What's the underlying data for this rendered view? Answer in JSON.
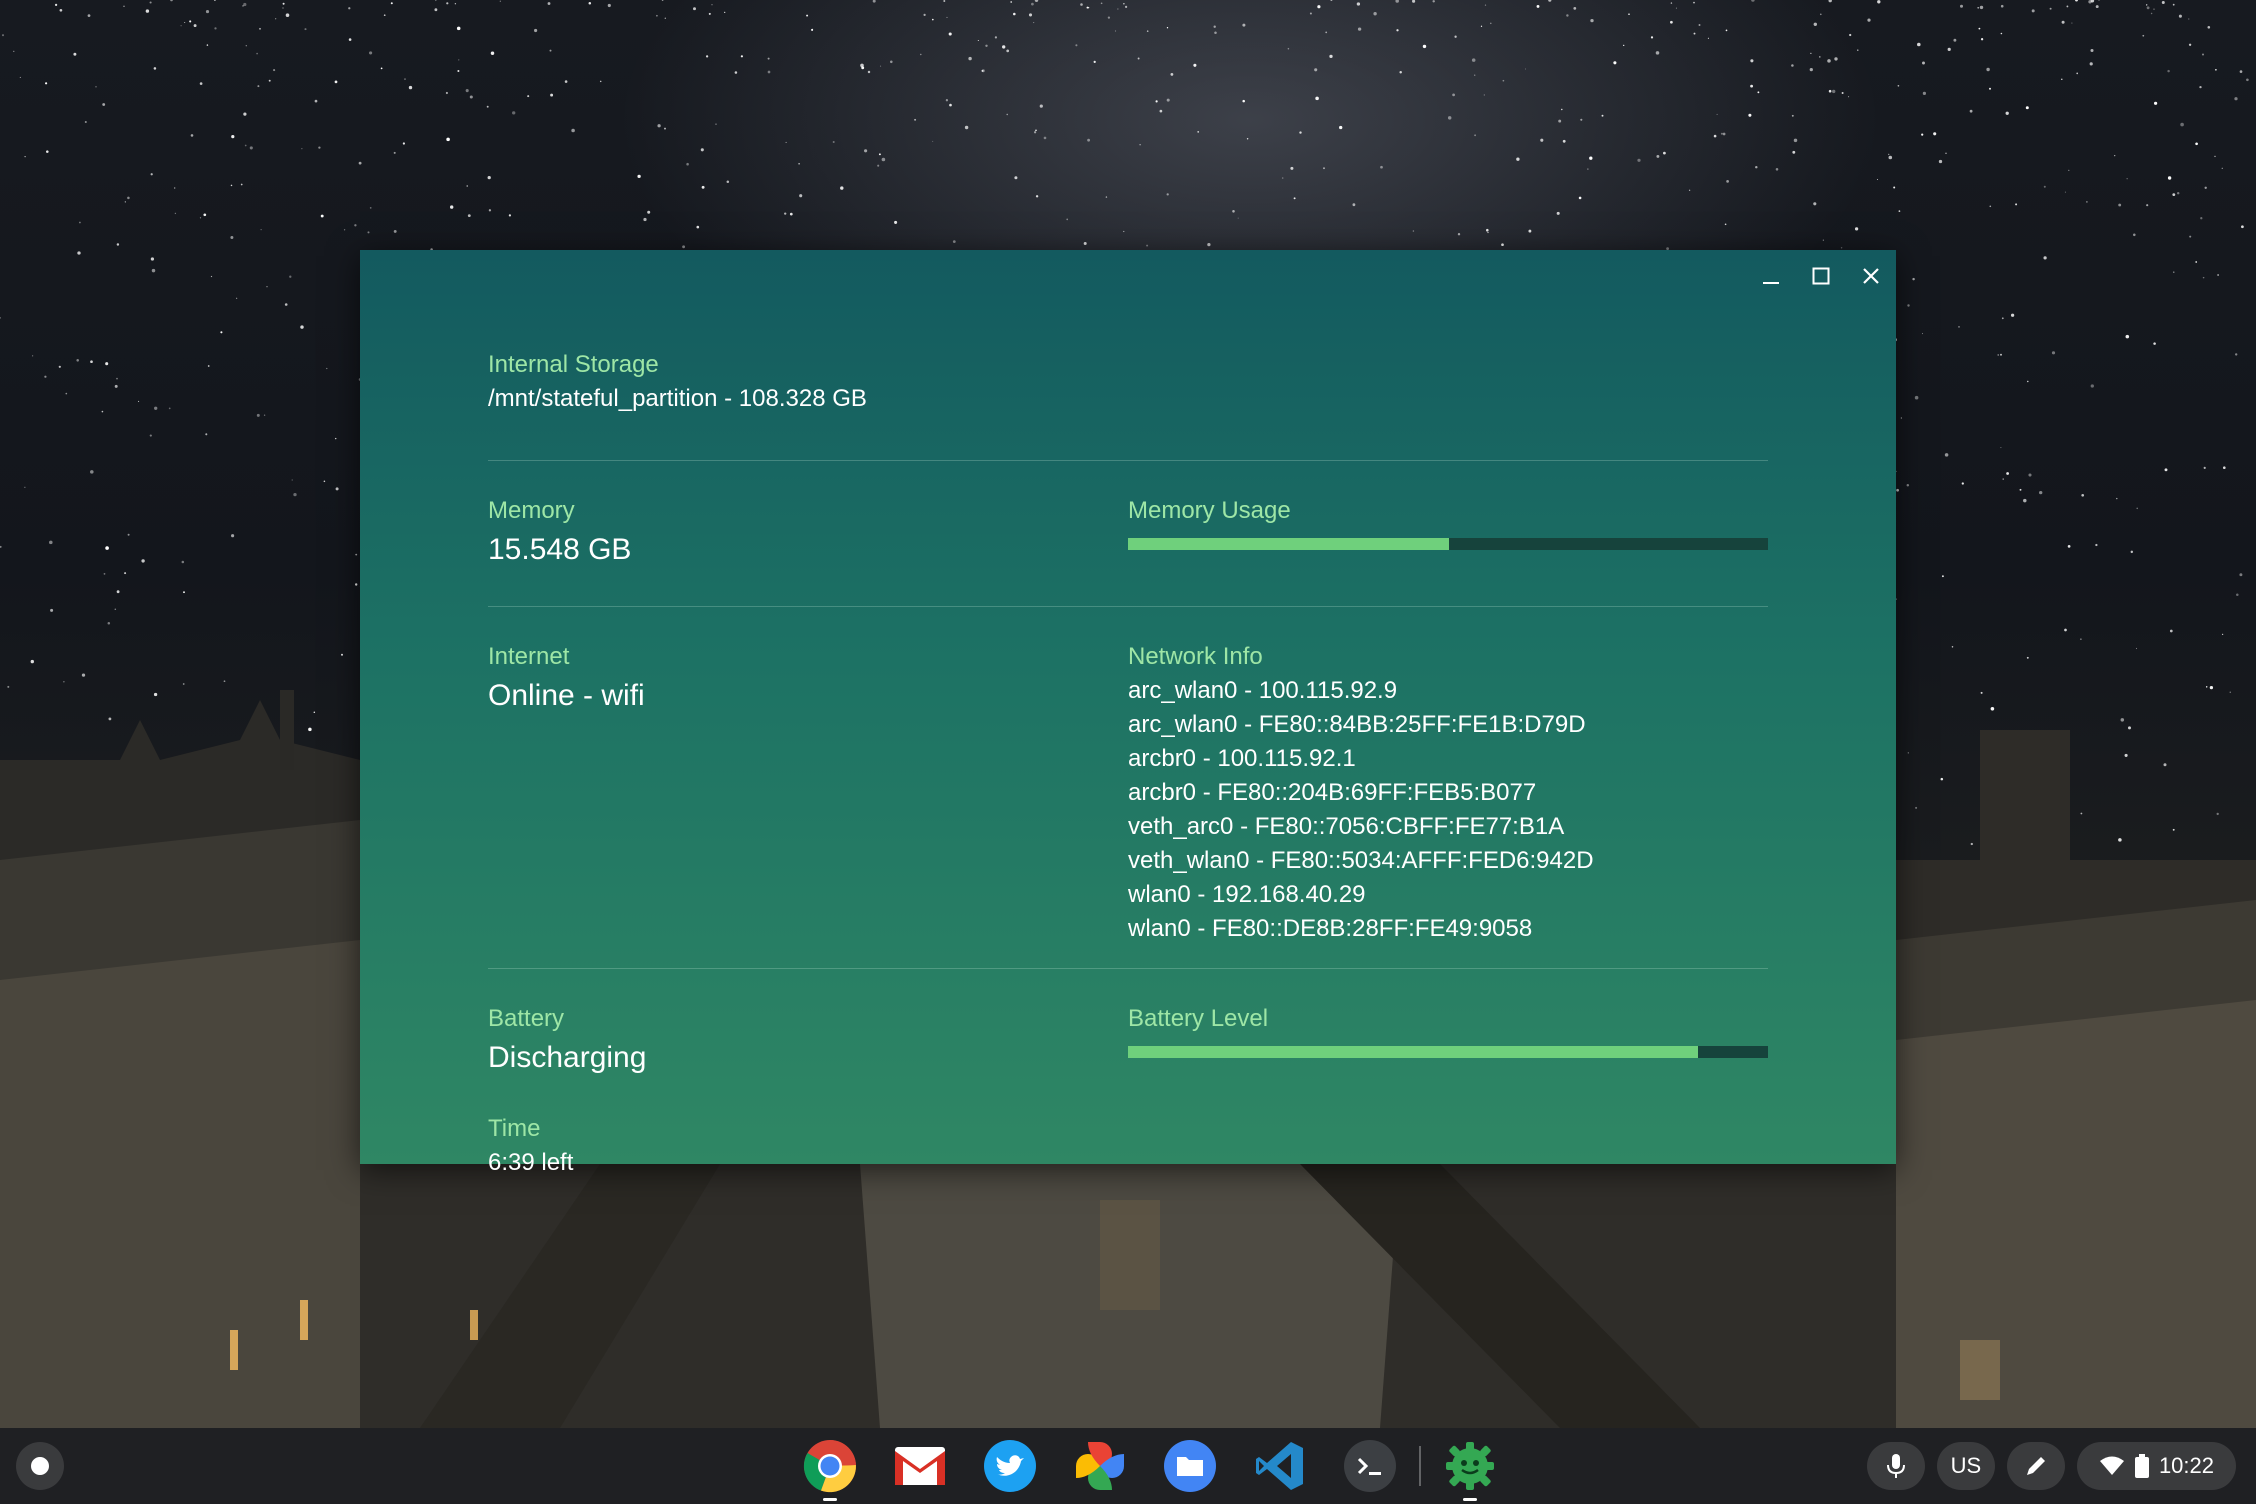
{
  "window": {
    "controls": {
      "minimize_icon": "minimize-icon",
      "maximize_icon": "maximize-icon",
      "close_icon": "close-icon"
    }
  },
  "storage": {
    "label": "Internal Storage",
    "value": "/mnt/stateful_partition - 108.328 GB"
  },
  "memory": {
    "label": "Memory",
    "value": "15.548 GB",
    "usage_label": "Memory Usage",
    "usage_fraction": 0.502
  },
  "internet": {
    "label": "Internet",
    "value": "Online - wifi"
  },
  "network": {
    "label": "Network Info",
    "lines": [
      "arc_wlan0 - 100.115.92.9",
      "arc_wlan0 - FE80::84BB:25FF:FE1B:D79D",
      "arcbr0 - 100.115.92.1",
      "arcbr0 - FE80::204B:69FF:FEB5:B077",
      "veth_arc0 - FE80::7056:CBFF:FE77:B1A",
      "veth_wlan0 - FE80::5034:AFFF:FED6:942D",
      "wlan0 - 192.168.40.29",
      "wlan0 - FE80::DE8B:28FF:FE49:9058"
    ]
  },
  "battery": {
    "label": "Battery",
    "value": "Discharging",
    "level_label": "Battery Level",
    "level_fraction": 0.89,
    "time_label": "Time",
    "time_value": "6:39 left"
  },
  "shelf": {
    "apps": [
      {
        "name": "chrome-icon"
      },
      {
        "name": "gmail-icon"
      },
      {
        "name": "twitter-icon"
      },
      {
        "name": "google-photos-icon"
      },
      {
        "name": "files-icon"
      },
      {
        "name": "vscode-icon"
      },
      {
        "name": "terminal-icon"
      },
      {
        "name": "cog-app-icon"
      }
    ],
    "tray": {
      "keyboard_layout": "US",
      "time": "10:22"
    }
  },
  "colors": {
    "accent": "#9ee6a6",
    "bar_fill": "#6fd07c",
    "bar_track": "#16433c"
  }
}
